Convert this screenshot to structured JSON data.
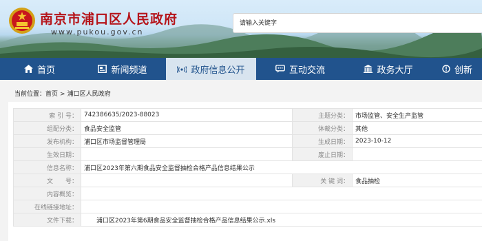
{
  "header": {
    "site_title": "南京市浦口区人民政府",
    "site_url": "www.pukou.gov.cn",
    "search_placeholder": "请输入关键字",
    "colors": {
      "nav_bg": "#21538d",
      "title_red": "#b5141a",
      "nav_active_bg": "#d8e4ef"
    }
  },
  "nav": {
    "items": [
      {
        "label": "首页",
        "icon": "home-icon"
      },
      {
        "label": "新闻频道",
        "icon": "news-icon"
      },
      {
        "label": "政府信息公开",
        "icon": "broadcast-icon",
        "active": true
      },
      {
        "label": "互动交流",
        "icon": "chat-icon"
      },
      {
        "label": "政务大厅",
        "icon": "building-icon"
      },
      {
        "label": "创新",
        "icon": "innovation-icon"
      }
    ]
  },
  "breadcrumb": {
    "prefix": "当前位置：",
    "items": [
      "首页",
      "浦口区人民政府"
    ],
    "separator": ">"
  },
  "meta": {
    "index_no_label": "索 引 号：",
    "index_no": "742386635/2023-88023",
    "topic_label": "主题分类：",
    "topic": "市场监管、安全生产监管",
    "org_cat_label": "组配分类：",
    "org_cat": "食品安全监管",
    "genre_label": "体裁分类：",
    "genre": "其他",
    "publisher_label": "发布机构：",
    "publisher": "浦口区市场监督管理局",
    "created_label": "生成日期：",
    "created": "2023-10-12",
    "effective_label": "生效日期：",
    "effective": "",
    "expire_label": "废止日期：",
    "expire": "",
    "name_label": "信息名称：",
    "name": "浦口区2023年第六期食品安全监督抽检合格产品信息结果公示",
    "docno_label": "文　　号：",
    "docno": "",
    "keywords_label": "关 键 词：",
    "keywords": "食品抽检",
    "summary_label": "内容概览：",
    "summary": "",
    "online_label": "在线链接地址：",
    "online": "",
    "download_label": "文件下载：",
    "download_file": "浦口区2023年第6期食品安全监督抽检合格产品信息结果公示.xls"
  }
}
